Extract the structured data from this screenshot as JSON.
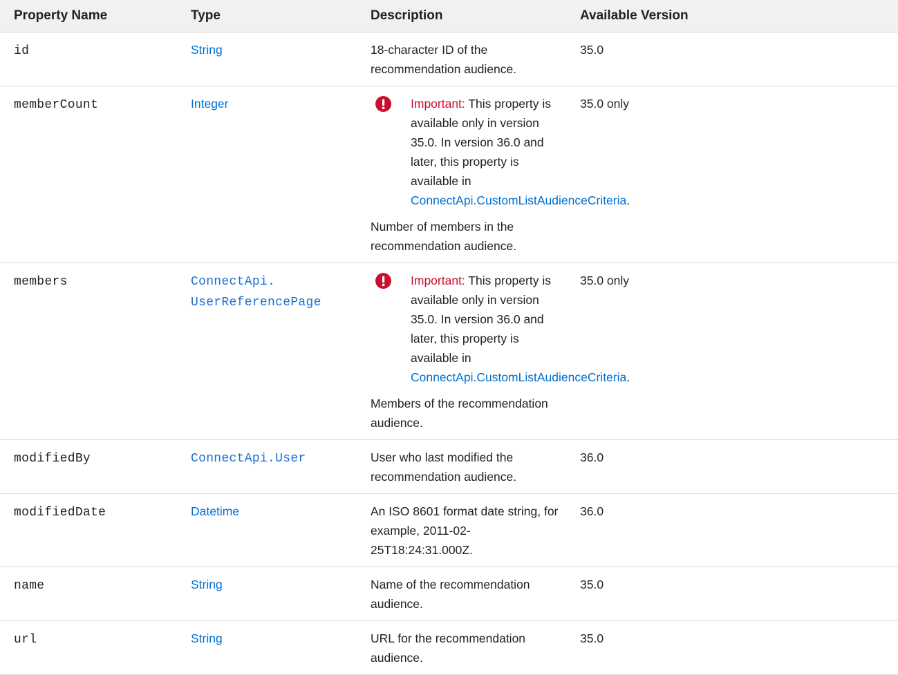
{
  "headers": {
    "name": "Property Name",
    "type": "Type",
    "description": "Description",
    "version": "Available Version"
  },
  "rows": [
    {
      "name": "id",
      "type": "String",
      "description": "18-character ID of the recommendation audience.",
      "version": "35.0"
    },
    {
      "name": "memberCount",
      "type": "Integer",
      "note_label": "Important:",
      "note_text": "This property is available only in version 35.0. In version 36.0 and later, this property is available in",
      "note_link": "ConnectApi.CustomListAudienceCriteria",
      "note_end": ".",
      "description": "Number of members in the recommendation audience.",
      "version": "35.0 only"
    },
    {
      "name": "members",
      "type_line1": "ConnectApi.",
      "type_line2": "UserReferencePage",
      "note_label": "Important:",
      "note_text": "This property is available only in version 35.0. In version 36.0 and later, this property is available in",
      "note_link": "ConnectApi.CustomListAudienceCriteria",
      "note_end": ".",
      "description": "Members of the recommendation audience.",
      "version": "35.0 only"
    },
    {
      "name": "modifiedBy",
      "type": "ConnectApi.User",
      "description": "User who last modified the recommendation audience.",
      "version": "36.0"
    },
    {
      "name": "modifiedDate",
      "type": "Datetime",
      "description": "An ISO 8601 format date string, for example, 2011-02-25T18:24:31.000Z.",
      "version": "36.0"
    },
    {
      "name": "name",
      "type": "String",
      "description": "Name of the recommendation audience.",
      "version": "35.0"
    },
    {
      "name": "url",
      "type": "String",
      "description": "URL for the recommendation audience.",
      "version": "35.0"
    }
  ],
  "colors": {
    "link": "#0070d2",
    "important": "#c8102e",
    "header_bg": "#f1f1f1"
  },
  "icons": {
    "important": "exclamation-circle-icon"
  }
}
